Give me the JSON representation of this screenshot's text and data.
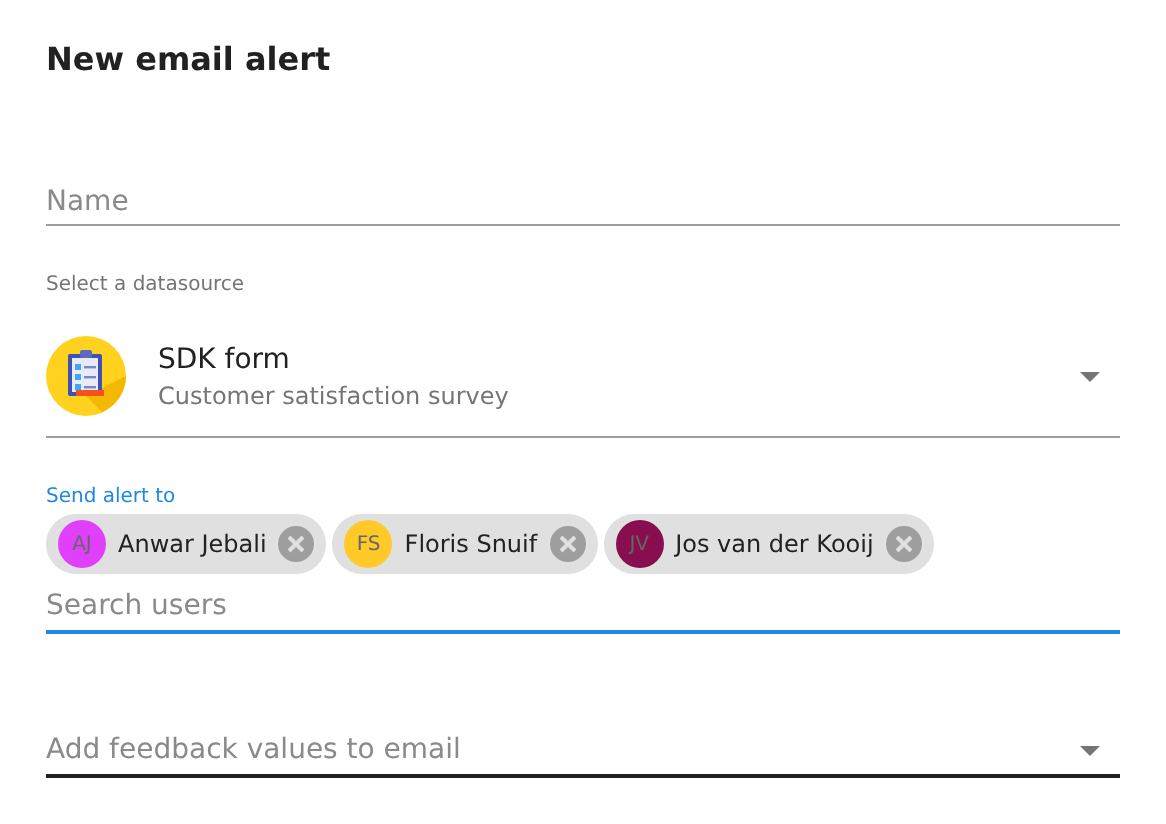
{
  "dialog": {
    "title": "New email alert"
  },
  "name_field": {
    "placeholder": "Name"
  },
  "datasource": {
    "label": "Select a datasource",
    "title": "SDK form",
    "subtitle": "Customer satisfaction survey"
  },
  "recipients": {
    "label": "Send alert to",
    "chips": [
      {
        "initials": "AJ",
        "name": "Anwar Jebali",
        "color": "#e040fb"
      },
      {
        "initials": "FS",
        "name": "Floris Snuif",
        "color": "#ffca28"
      },
      {
        "initials": "JV",
        "name": "Jos van der Kooij",
        "color": "#880e4f"
      }
    ],
    "search": {
      "placeholder": "Search users",
      "focused": true
    }
  },
  "feedback_field": {
    "placeholder": "Add feedback values to email"
  }
}
